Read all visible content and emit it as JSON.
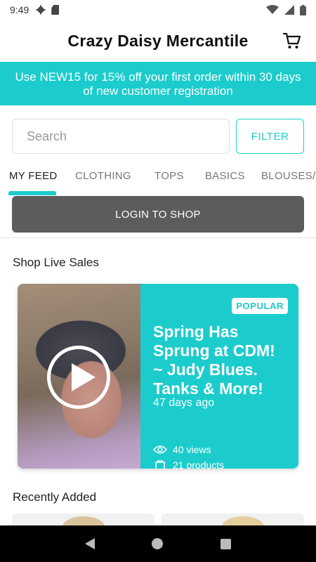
{
  "status": {
    "time": "9:49",
    "icons": [
      "gear-icon",
      "sd-card-icon",
      "wifi-icon",
      "signal-icon",
      "battery-icon"
    ]
  },
  "header": {
    "title": "Crazy Daisy Mercantile",
    "cart_icon": "cart-icon"
  },
  "promo": {
    "text": "Use NEW15 for 15% off your first order within 30 days of  new customer registration"
  },
  "search": {
    "placeholder": "Search",
    "filter_label": "FILTER"
  },
  "tabs": [
    {
      "label": "MY FEED",
      "active": true
    },
    {
      "label": "CLOTHING",
      "active": false
    },
    {
      "label": "TOPS",
      "active": false
    },
    {
      "label": "BASICS",
      "active": false
    },
    {
      "label": "BLOUSES/S",
      "active": false
    }
  ],
  "login": {
    "label": "LOGIN TO SHOP"
  },
  "live_sales": {
    "title": "Shop Live Sales",
    "card": {
      "badge": "POPULAR",
      "title": "Spring Has Sprung at CDM! ~ Judy Blues. Tanks & More!",
      "age": "47 days ago",
      "views": "40 views",
      "products": "21 products"
    }
  },
  "recent": {
    "title": "Recently Added"
  },
  "colors": {
    "accent": "#1ccccc",
    "login_bg": "#5c5c5c"
  },
  "nav": {
    "icons": [
      "back-icon",
      "home-icon",
      "recents-icon"
    ]
  }
}
